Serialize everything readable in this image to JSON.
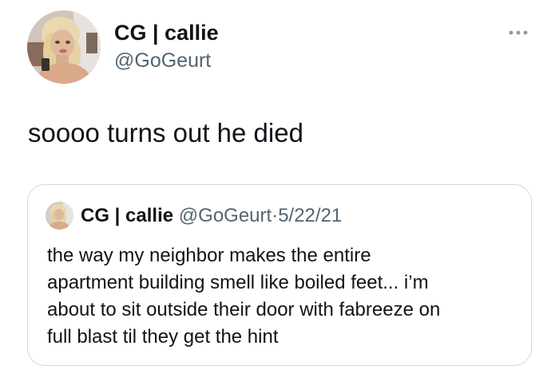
{
  "author": {
    "display_name": "CG | callie",
    "handle": "@GoGeurt",
    "avatar": "profile-photo"
  },
  "more_icon": "more-horizontal-icon",
  "tweet": {
    "text": "soooo turns out he died"
  },
  "quoted_tweet": {
    "display_name": "CG | callie",
    "handle": "@GoGeurt",
    "separator": "·",
    "date": "5/22/21",
    "text_lines": [
      "the way my neighbor makes the entire",
      "apartment building smell like boiled feet... i’m",
      "about to sit outside their door with fabreeze on",
      "full blast til they get the hint"
    ]
  },
  "colors": {
    "text_primary": "#0f1419",
    "text_secondary": "#536471",
    "border": "#cfd9de",
    "background": "#ffffff"
  }
}
